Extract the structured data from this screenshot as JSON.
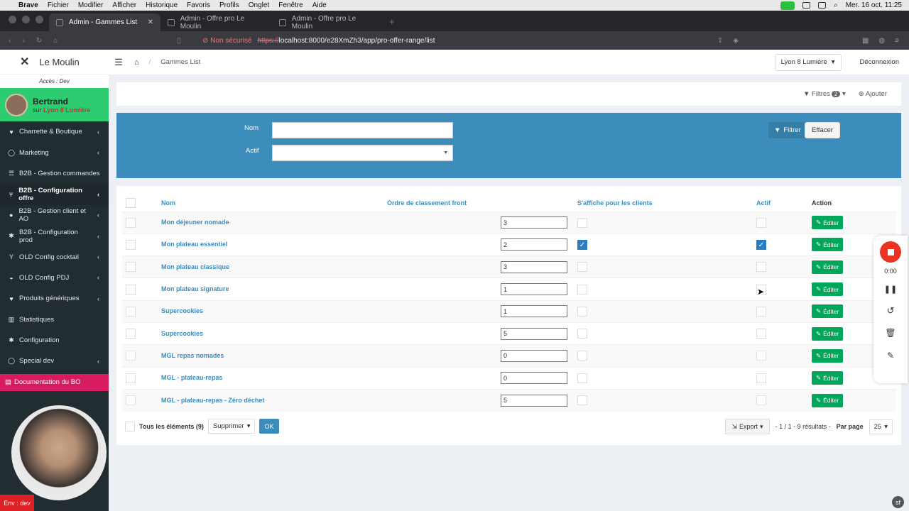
{
  "os_menu": {
    "items": [
      "Brave",
      "Fichier",
      "Modifier",
      "Afficher",
      "Historique",
      "Favoris",
      "Profils",
      "Onglet",
      "Fenêtre",
      "Aide"
    ],
    "clock": "Mer. 16 oct.  11:25"
  },
  "browser": {
    "tabs": [
      {
        "label": "Admin - Gammes List"
      },
      {
        "label": "Admin - Offre pro Le Moulin"
      },
      {
        "label": "Admin - Offre pro Le Moulin"
      }
    ],
    "insecure_label": "Non sécurisé",
    "url_scheme": "https://",
    "url_rest": "localhost:8000/e28XmZh3/app/pro-offer-range/list"
  },
  "sidebar": {
    "brand": "Le Moulin",
    "access": "Accès : Dev",
    "user_name": "Bertrand",
    "user_prefix": "sur",
    "user_site": "Lyon 8 Lumière",
    "items": [
      {
        "label": "Charrette & Boutique",
        "icon": "heart-icon"
      },
      {
        "label": "Marketing",
        "icon": "chat-icon"
      },
      {
        "label": "B2B - Gestion commandes",
        "icon": "list-icon"
      },
      {
        "label": "B2B - Configuration offre",
        "icon": "utensils-icon"
      },
      {
        "label": "B2B - Gestion client et AO",
        "icon": "user-icon"
      },
      {
        "label": "B2B - Configuration prod",
        "icon": "gear-icon"
      },
      {
        "label": "OLD Config cocktail",
        "icon": "glass-icon"
      },
      {
        "label": "OLD Config PDJ",
        "icon": "coffee-icon"
      },
      {
        "label": "Produits génériques",
        "icon": "heart-icon"
      },
      {
        "label": "Statistiques",
        "icon": "chart-icon"
      },
      {
        "label": "Configuration",
        "icon": "gear-icon"
      },
      {
        "label": "Special dev",
        "icon": "chat-icon"
      }
    ],
    "doc_label": "Documentation du BO",
    "env_label": "Env : dev"
  },
  "header": {
    "breadcrumb": "Gammes List",
    "site_select": "Lyon 8 Lumière",
    "logout": "Déconnexion"
  },
  "toolbar": {
    "filters_label": "Filtres",
    "filters_count": "2",
    "add_label": "Ajouter"
  },
  "filters": {
    "name_label": "Nom",
    "name_value": "",
    "active_label": "Actif",
    "active_value": "",
    "filter_button": "Filtrer",
    "clear_button": "Effacer"
  },
  "table": {
    "headers": {
      "name": "Nom",
      "order": "Ordre de classement front",
      "display": "S'affiche pour les clients",
      "active": "Actif",
      "action": "Action"
    },
    "edit_label": "Éditer",
    "rows": [
      {
        "name": "Mon déjeuner nomade",
        "order": "3",
        "display": false,
        "active": false
      },
      {
        "name": "Mon plateau essentiel",
        "order": "2",
        "display": true,
        "active": true
      },
      {
        "name": "Mon plateau classique",
        "order": "3",
        "display": false,
        "active": false
      },
      {
        "name": "Mon plateau signature",
        "order": "1",
        "display": false,
        "active": false
      },
      {
        "name": "Supercookies",
        "order": "1",
        "display": false,
        "active": false
      },
      {
        "name": "Supercookies",
        "order": "5",
        "display": false,
        "active": false
      },
      {
        "name": "MGL repas nomades",
        "order": "0",
        "display": false,
        "active": false
      },
      {
        "name": "MGL - plateau-repas",
        "order": "0",
        "display": false,
        "active": false
      },
      {
        "name": "MGL - plateau-repas - Zéro déchet",
        "order": "5",
        "display": false,
        "active": false
      }
    ]
  },
  "footer": {
    "all_label": "Tous les éléments (9)",
    "batch_action": "Supprimer",
    "ok": "OK",
    "export": "Export",
    "pages": "- 1 / 1 - 9 résultats -",
    "per_page_label": "Par page",
    "per_page": "25"
  },
  "recorder": {
    "time": "0:00"
  }
}
